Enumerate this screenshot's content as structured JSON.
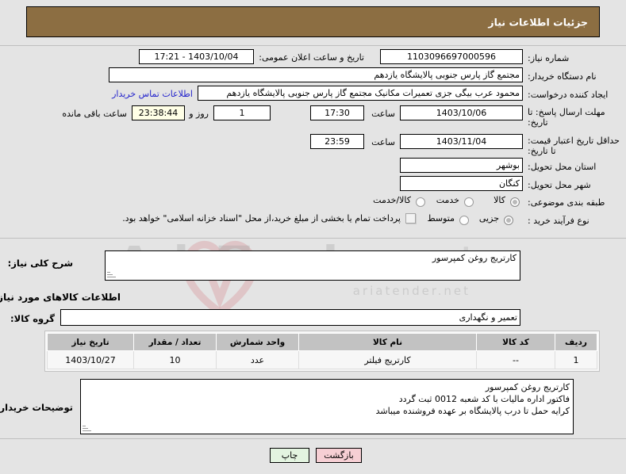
{
  "header": {
    "title": "جزئیات اطلاعات نیاز"
  },
  "watermark": {
    "text": "AriaTender",
    "suffix": ".net",
    "sub": "ariatender.net"
  },
  "need_info": {
    "need_number_label": "شماره نیاز:",
    "need_number_value": "1103096697000596",
    "announce_datetime_label": "تاریخ و ساعت اعلان عمومی:",
    "announce_datetime_value": "1403/10/04 - 17:21",
    "buyer_org_label": "نام دستگاه خریدار:",
    "buyer_org_value": "مجتمع گاز پارس جنوبی  پالایشگاه یازدهم",
    "requester_label": "ایجاد کننده درخواست:",
    "requester_value": "محمود عرب بیگی جزی تعمیرات مکانیک مجتمع گاز پارس جنوبی  پالایشگاه یازدهم",
    "contact_link": "اطلاعات تماس خریدار",
    "reply_deadline_label": "مهلت ارسال پاسخ: تا تاریخ:",
    "reply_deadline_date": "1403/10/06",
    "reply_deadline_hour_label": "ساعت",
    "reply_deadline_time": "17:30",
    "remaining_days": "1",
    "remaining_days_label": "روز و",
    "remaining_time": "23:38:44",
    "remaining_suffix": "ساعت باقی مانده",
    "price_validity_label": "حداقل تاریخ اعتبار قیمت: تا تاریخ:",
    "price_validity_date": "1403/11/04",
    "price_validity_hour_label": "ساعت",
    "price_validity_time": "23:59",
    "province_label": "استان محل تحویل:",
    "province_value": "بوشهر",
    "city_label": "شهر محل تحویل:",
    "city_value": "کنگان",
    "subject_class_label": "طبقه بندی موضوعی:",
    "subject_options": [
      {
        "label": "کالا",
        "selected": true
      },
      {
        "label": "خدمت",
        "selected": false
      },
      {
        "label": "کالا/خدمت",
        "selected": false
      }
    ],
    "process_type_label": "نوع فرآیند خرید :",
    "process_options": [
      {
        "label": "جزیی",
        "selected": true
      },
      {
        "label": "متوسط",
        "selected": false
      }
    ],
    "treasury_checkbox_label": "پرداخت تمام یا بخشی از مبلغ خرید،از محل \"اسناد خزانه اسلامی\" خواهد بود.",
    "treasury_checked": false
  },
  "summary": {
    "need_summary_label": "شرح کلی نیاز:",
    "need_summary_value": "کارتریج  روغن کمپرسور",
    "goods_section_title": "اطلاعات کالاهای مورد نیاز",
    "goods_group_label": "گروه کالا:",
    "goods_group_value": "تعمیر و نگهداری"
  },
  "table": {
    "columns": [
      "ردیف",
      "کد کالا",
      "نام کالا",
      "واحد شمارش",
      "تعداد / مقدار",
      "تاریخ نیاز"
    ],
    "rows": [
      {
        "index": "1",
        "code": "--",
        "name": "کارتریج فیلتر",
        "unit": "عدد",
        "quantity": "10",
        "need_date": "1403/10/27"
      }
    ]
  },
  "buyer_notes": {
    "label": "توضیحات خریدار:",
    "line1": "کارتریج  روغن کمپرسور",
    "line2": "فاکتور اداره مالیات با کد شعبه 0012 ثبت گردد",
    "line3": "کرایه حمل  تا درب پالایشگاه بر عهده فروشنده میباشد"
  },
  "actions": {
    "back_label": "بازگشت",
    "print_label": "چاپ"
  },
  "colors": {
    "header_brown": "#8c6e42",
    "page_bg": "#e4e4e4",
    "link_blue": "#2222cc",
    "back_btn": "#f6cfd4",
    "print_btn": "#e3f4e0",
    "cream_field": "#ffffe6",
    "table_header": "#c2c2c2"
  }
}
